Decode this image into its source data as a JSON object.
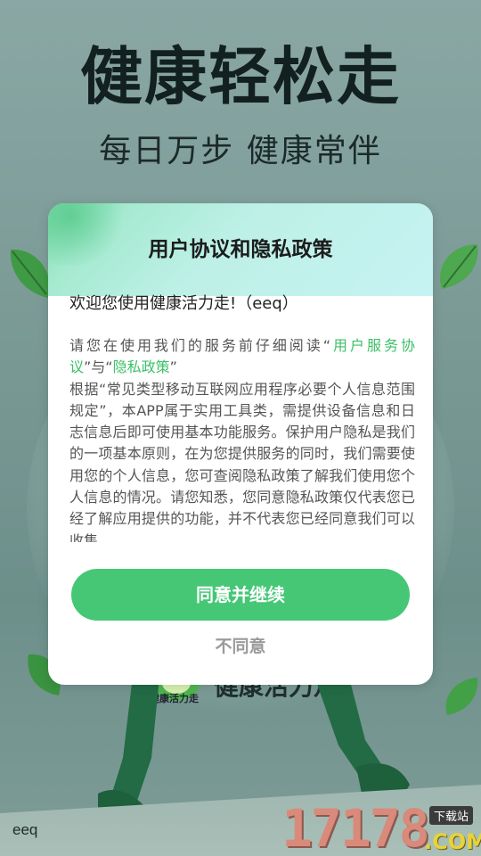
{
  "splash": {
    "headline": "健康轻松走",
    "subline": "每日万步 健康常伴",
    "logo_name": "健康活力走",
    "logo_small": "健康活力走"
  },
  "dialog": {
    "title": "用户协议和隐私政策",
    "welcome": "欢迎您使用健康活力走!（eeq）",
    "intro_prefix": "请您在使用我们的服务前仔细阅读“",
    "user_agreement_link": "用户服务协议",
    "intro_mid": "”与“",
    "privacy_link": "隐私政策",
    "intro_suffix": "”",
    "body": "根据“常见类型移动互联网应用程序必要个人信息范围规定”，本APP属于实用工具类，需提供设备信息和日志信息后即可使用基本功能服务。保护用户隐私是我们的一项基本原则，在为您提供服务的同时，我们需要使用您的个人信息，您可查阅隐私政策了解我们使用您个人信息的情况。请您知悉，您同意隐私政策仅代表您已经了解应用提供的功能，并不代表您已经同意我们可以收集",
    "agree_label": "同意并继续",
    "disagree_label": "不同意"
  },
  "footer": {
    "tag": "eeq"
  },
  "watermark": {
    "digits": "17178",
    "tag": "下载站",
    "suffix": ".COM"
  },
  "colors": {
    "accent": "#46c776",
    "link": "#3cc068"
  }
}
